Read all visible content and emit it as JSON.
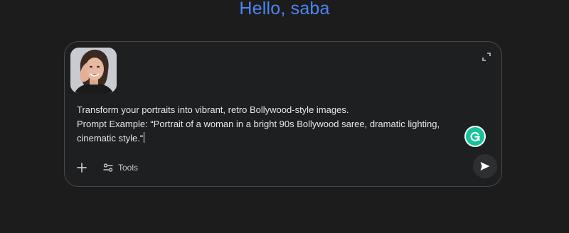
{
  "greeting": {
    "text": "Hello, saba"
  },
  "composer": {
    "attachment": {
      "name": "portrait-thumbnail"
    },
    "prompt_lines": [
      "Transform your portraits into vibrant, retro Bollywood-style images.",
      "Prompt Example: “Portrait of a woman in a bright 90s Bollywood saree, dramatic lighting,",
      "cinematic style.“"
    ],
    "toolbar": {
      "tools_label": "Tools"
    },
    "icons": {
      "expand": "expand-icon",
      "plus": "plus-icon",
      "tools": "tools-sliders-icon",
      "send": "send-icon",
      "grammarly": "grammarly-icon"
    }
  },
  "colors": {
    "background": "#1c1c1d",
    "greeting": "#4a86f0",
    "composer_border": "#47484b",
    "grammarly": "#15c39a"
  }
}
